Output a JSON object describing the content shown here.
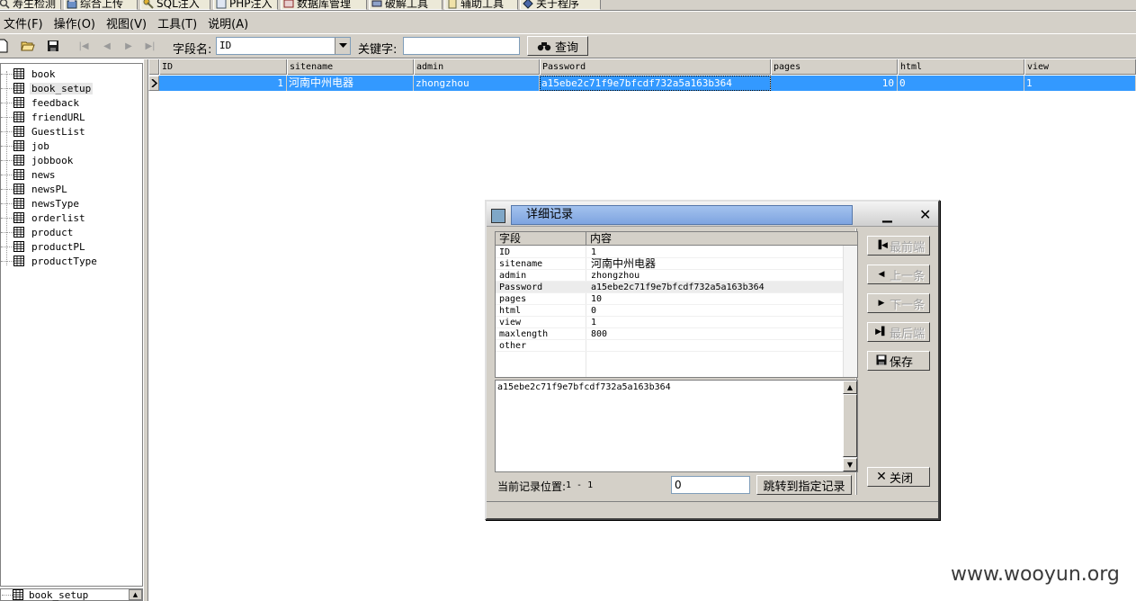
{
  "tabs": [
    {
      "label": "寿生检测",
      "icon": "magnifier-icon"
    },
    {
      "label": "综合上传",
      "icon": "upload-icon"
    },
    {
      "label": "SQL注入",
      "icon": "wrench-icon"
    },
    {
      "label": "PHP注入",
      "icon": "php-icon"
    },
    {
      "label": "数据库管理",
      "icon": "database-icon"
    },
    {
      "label": "破解工具",
      "icon": "tool-icon"
    },
    {
      "label": "辅助工具",
      "icon": "tool-icon"
    },
    {
      "label": "关于程序",
      "icon": "info-icon"
    }
  ],
  "menu": [
    "文件(F)",
    "操作(O)",
    "视图(V)",
    "工具(T)",
    "说明(A)"
  ],
  "toolbar": {
    "field_label": "字段名:",
    "field_value": "ID",
    "keyword_label": "关键字:",
    "keyword_value": "",
    "query_label": "查询"
  },
  "tree": {
    "items": [
      "book",
      "book_setup",
      "feedback",
      "friendURL",
      "GuestList",
      "job",
      "jobbook",
      "news",
      "newsPL",
      "newsType",
      "orderlist",
      "product",
      "productPL",
      "productType"
    ],
    "selected": "book_setup",
    "bottom_combo": "book_setup"
  },
  "grid": {
    "columns": [
      "ID",
      "sitename",
      "admin",
      "Password",
      "pages",
      "html",
      "view"
    ],
    "rows": [
      [
        "1",
        "河南中州电器",
        "zhongzhou",
        "a15ebe2c71f9e7bfcdf732a5a163b364",
        "10",
        "0",
        "1"
      ]
    ]
  },
  "dialog": {
    "title": "详细记录",
    "col_field": "字段",
    "col_content": "内容",
    "records": [
      {
        "k": "ID",
        "v": "1"
      },
      {
        "k": "sitename",
        "v": "河南中州电器"
      },
      {
        "k": "admin",
        "v": "zhongzhou"
      },
      {
        "k": "Password",
        "v": "a15ebe2c71f9e7bfcdf732a5a163b364"
      },
      {
        "k": "pages",
        "v": "10"
      },
      {
        "k": "html",
        "v": "0"
      },
      {
        "k": "view",
        "v": "1"
      },
      {
        "k": "maxlength",
        "v": "800"
      },
      {
        "k": "other",
        "v": ""
      }
    ],
    "memo": "a15ebe2c71f9e7bfcdf732a5a163b364",
    "pos_label": "当前记录位置:",
    "pos_value": "1 - 1",
    "jump_value": "0",
    "jump_label": "跳转到指定记录",
    "btn_first": "最前端",
    "btn_prev": "上一条",
    "btn_next": "下一条",
    "btn_last": "最后端",
    "btn_save": "保存",
    "btn_close": "关闭"
  },
  "watermark": "www.wooyun.org"
}
